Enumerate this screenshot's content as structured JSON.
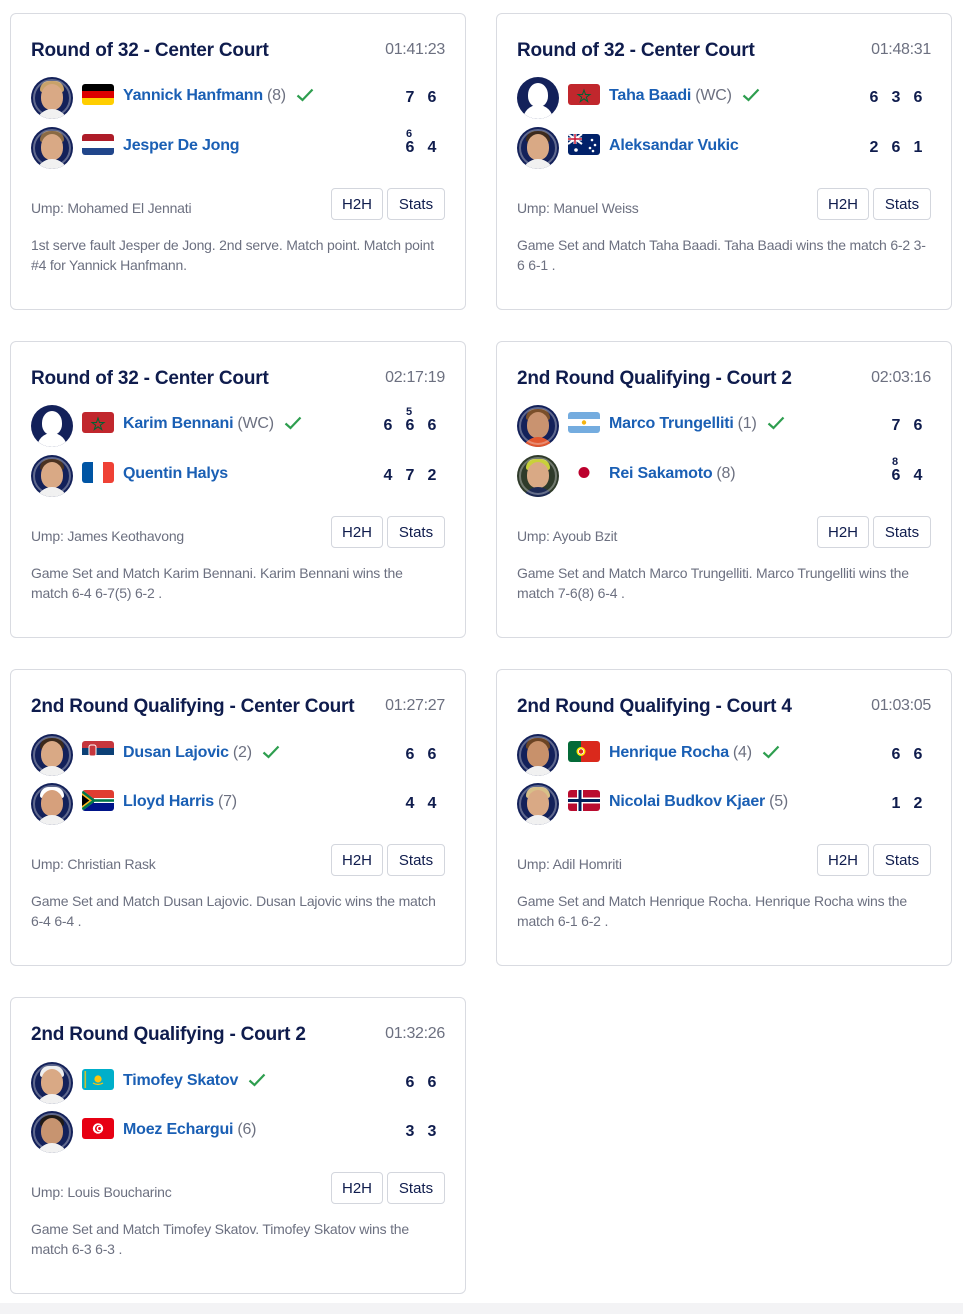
{
  "cards": [
    {
      "title": "Round of 32 - Center Court",
      "time": "01:41:23",
      "players": [
        {
          "name": "Yannick Hanfmann",
          "seed": "(8)",
          "flag": "germany",
          "winner": true,
          "scores": [
            "7",
            "6"
          ],
          "tb": [
            "",
            ""
          ]
        },
        {
          "name": "Jesper De Jong",
          "seed": "",
          "flag": "netherlands",
          "winner": false,
          "scores": [
            "6",
            "4"
          ],
          "tb": [
            "6",
            ""
          ]
        }
      ],
      "umpire": "Ump: Mohamed El Jennati",
      "h2h": "H2H",
      "stats": "Stats",
      "description": "1st serve fault Jesper de Jong. 2nd serve. Match point. Match point #4 for Yannick Hanfmann."
    },
    {
      "title": "Round of 32 - Center Court",
      "time": "01:48:31",
      "players": [
        {
          "name": "Taha Baadi",
          "seed": "(WC)",
          "flag": "morocco",
          "winner": true,
          "scores": [
            "6",
            "3",
            "6"
          ],
          "tb": [
            "",
            "",
            ""
          ]
        },
        {
          "name": "Aleksandar Vukic",
          "seed": "",
          "flag": "australia",
          "winner": false,
          "scores": [
            "2",
            "6",
            "1"
          ],
          "tb": [
            "",
            "",
            ""
          ]
        }
      ],
      "umpire": "Ump: Manuel Weiss",
      "h2h": "H2H",
      "stats": "Stats",
      "description": "Game Set and Match Taha Baadi. Taha Baadi wins the match 6-2 3-6 6-1 ."
    },
    {
      "title": "Round of 32 - Center Court",
      "time": "02:17:19",
      "players": [
        {
          "name": "Karim Bennani",
          "seed": "(WC)",
          "flag": "morocco",
          "winner": true,
          "scores": [
            "6",
            "6",
            "6"
          ],
          "tb": [
            "",
            "5",
            ""
          ]
        },
        {
          "name": "Quentin Halys",
          "seed": "",
          "flag": "france",
          "winner": false,
          "scores": [
            "4",
            "7",
            "2"
          ],
          "tb": [
            "",
            "",
            ""
          ]
        }
      ],
      "umpire": "Ump: James Keothavong",
      "h2h": "H2H",
      "stats": "Stats",
      "description": "Game Set and Match Karim Bennani. Karim Bennani wins the match 6-4 6-7(5) 6-2 ."
    },
    {
      "title": "2nd Round Qualifying - Court 2",
      "time": "02:03:16",
      "players": [
        {
          "name": "Marco Trungelliti",
          "seed": "(1)",
          "flag": "argentina",
          "winner": true,
          "scores": [
            "7",
            "6"
          ],
          "tb": [
            "",
            ""
          ]
        },
        {
          "name": "Rei Sakamoto",
          "seed": "(8)",
          "flag": "japan",
          "winner": false,
          "scores": [
            "6",
            "4"
          ],
          "tb": [
            "8",
            ""
          ]
        }
      ],
      "umpire": "Ump: Ayoub Bzit",
      "h2h": "H2H",
      "stats": "Stats",
      "description": "Game Set and Match Marco Trungelliti. Marco Trungelliti wins the match 7-6(8) 6-4 ."
    },
    {
      "title": "2nd Round Qualifying - Center Court",
      "time": "01:27:27",
      "players": [
        {
          "name": "Dusan Lajovic",
          "seed": "(2)",
          "flag": "serbia",
          "winner": true,
          "scores": [
            "6",
            "6"
          ],
          "tb": [
            "",
            ""
          ]
        },
        {
          "name": "Lloyd Harris",
          "seed": "(7)",
          "flag": "south-africa",
          "winner": false,
          "scores": [
            "4",
            "4"
          ],
          "tb": [
            "",
            ""
          ]
        }
      ],
      "umpire": "Ump: Christian Rask",
      "h2h": "H2H",
      "stats": "Stats",
      "description": "Game Set and Match Dusan Lajovic. Dusan Lajovic wins the match 6-4 6-4 ."
    },
    {
      "title": "2nd Round Qualifying - Court 4",
      "time": "01:03:05",
      "players": [
        {
          "name": "Henrique Rocha",
          "seed": "(4)",
          "flag": "portugal",
          "winner": true,
          "scores": [
            "6",
            "6"
          ],
          "tb": [
            "",
            ""
          ]
        },
        {
          "name": "Nicolai Budkov Kjaer",
          "seed": "(5)",
          "flag": "norway",
          "winner": false,
          "scores": [
            "1",
            "2"
          ],
          "tb": [
            "",
            ""
          ]
        }
      ],
      "umpire": "Ump: Adil Homriti",
      "h2h": "H2H",
      "stats": "Stats",
      "description": "Game Set and Match Henrique Rocha. Henrique Rocha wins the match 6-1 6-2 ."
    },
    {
      "title": "2nd Round Qualifying - Court 2",
      "time": "01:32:26",
      "players": [
        {
          "name": "Timofey Skatov",
          "seed": "",
          "flag": "kazakhstan",
          "winner": true,
          "scores": [
            "6",
            "6"
          ],
          "tb": [
            "",
            ""
          ]
        },
        {
          "name": "Moez Echargui",
          "seed": "(6)",
          "flag": "tunisia",
          "winner": false,
          "scores": [
            "3",
            "3"
          ],
          "tb": [
            "",
            ""
          ]
        }
      ],
      "umpire": "Ump: Louis Boucharinc",
      "h2h": "H2H",
      "stats": "Stats",
      "description": "Game Set and Match Timofey Skatov. Timofey Skatov wins the match 6-3 6-3 ."
    }
  ],
  "colors": {
    "title": "#0f1c4d",
    "player_link": "#1a5fb4",
    "muted": "#6c7080",
    "winner_check": "#2e9e4f",
    "border": "#d9dbe1"
  }
}
